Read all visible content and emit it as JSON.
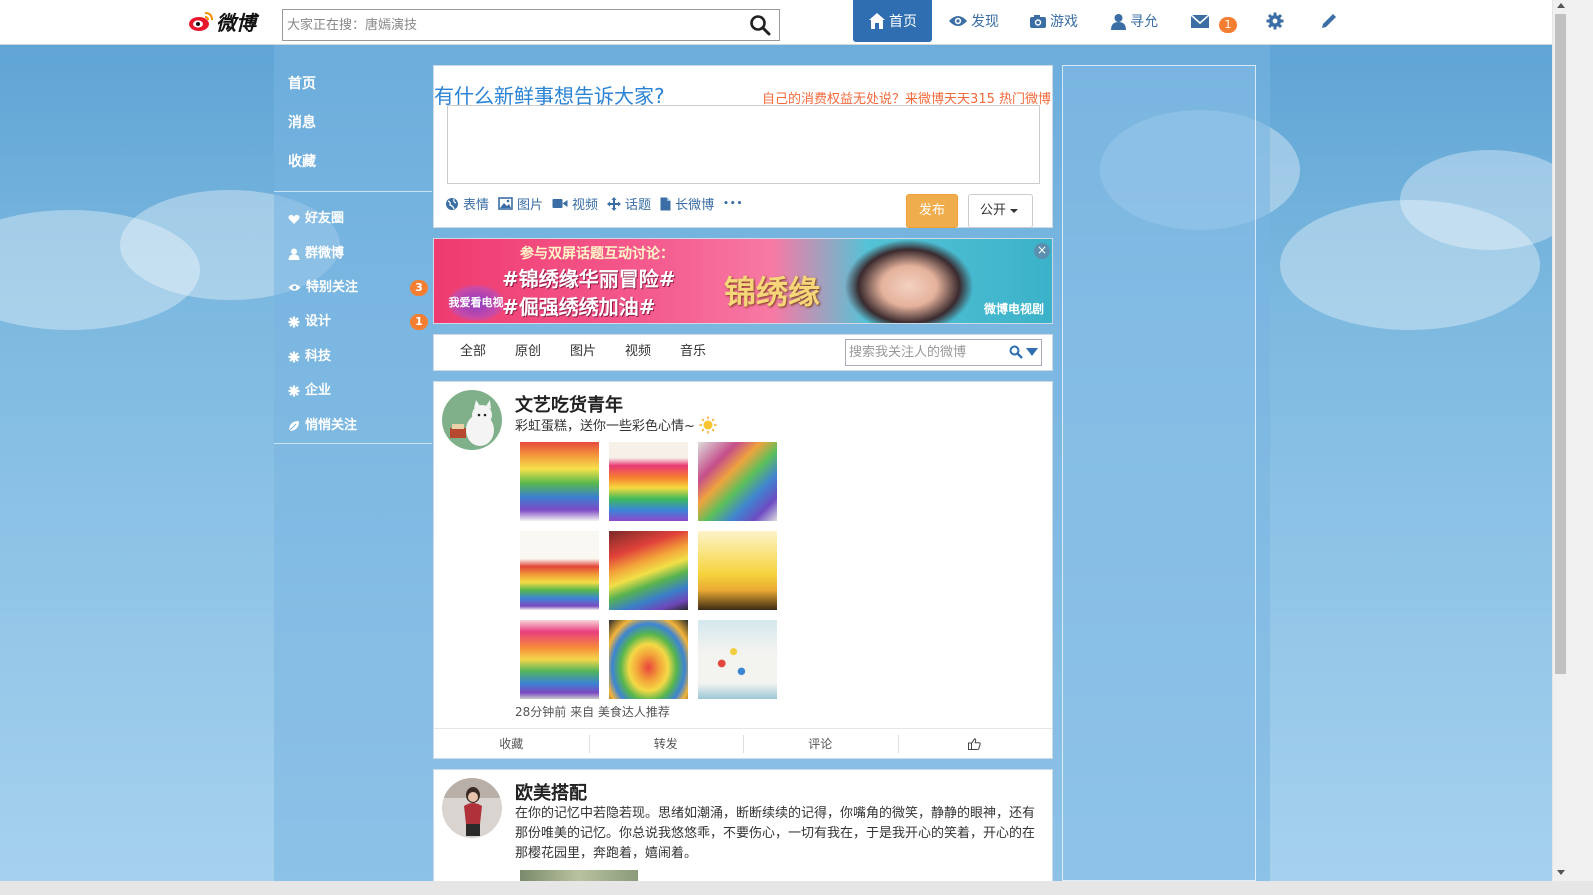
{
  "header": {
    "logo_text": "微博",
    "search_placeholder": "大家正在搜：唐嫣演技",
    "nav": [
      {
        "label": "首页",
        "icon": "home-icon",
        "active": true
      },
      {
        "label": "发现",
        "icon": "eye-icon"
      },
      {
        "label": "游戏",
        "icon": "camera-icon"
      },
      {
        "label": "寻允",
        "icon": "user-icon"
      },
      {
        "label": "",
        "icon": "mail-icon",
        "badge": "1"
      },
      {
        "label": "",
        "icon": "gear-icon"
      },
      {
        "label": "",
        "icon": "pencil-icon"
      }
    ]
  },
  "sidebar": {
    "main": [
      "首页",
      "消息",
      "收藏"
    ],
    "groups": [
      {
        "label": "好友圈",
        "icon": "heart-icon"
      },
      {
        "label": "群微博",
        "icon": "user-icon"
      },
      {
        "label": "特别关注",
        "icon": "eye-icon",
        "badge": "3"
      },
      {
        "label": "设计",
        "icon": "asterisk-icon",
        "badge": "1"
      },
      {
        "label": "科技",
        "icon": "asterisk-icon"
      },
      {
        "label": "企业",
        "icon": "asterisk-icon"
      },
      {
        "label": "悄悄关注",
        "icon": "leaf-icon"
      }
    ]
  },
  "publisher": {
    "title": "有什么新鲜事想告诉大家?",
    "hot_tip": "自己的消费权益无处说？来微博天天315 热门微博",
    "tools": [
      "表情",
      "图片",
      "视频",
      "话题",
      "长微博"
    ],
    "more": "•••",
    "submit": "发布",
    "visibility": "公开"
  },
  "banner": {
    "headline": "参与双屏话题互动讨论：",
    "tag1": "#锦绣缘华丽冒险#",
    "tag2": "#倔强绣绣加油#",
    "logo": "锦绣缘",
    "brand": "微博电视剧",
    "badge": "我爱看电视剧",
    "close": "×"
  },
  "filter": {
    "tabs": [
      "全部",
      "原创",
      "图片",
      "视频",
      "音乐"
    ],
    "search_placeholder": "搜索我关注人的微博"
  },
  "posts": [
    {
      "author": "文艺吃货青年",
      "text": "彩虹蛋糕，送你一些彩色心情~",
      "meta": "28分钟前 来自 美食达人推荐",
      "actions": [
        "收藏",
        "转发",
        "评论",
        ""
      ]
    },
    {
      "author": "欧美搭配",
      "text": "在你的记忆中若隐若现。思绪如潮涌，断断续续的记得，你嘴角的微笑，静静的眼神，还有那份唯美的记忆。你总说我悠悠乖，不要伤心，一切有我在，于是我开心的笑着，开心的在那樱花园里，奔跑着，嬉闹着。"
    }
  ],
  "colors": {
    "accent": "#2f6fb1",
    "link": "#3a6ea5",
    "badge": "#f47f32",
    "hot_tip": "#f26a3b",
    "submit": "#f0ad4e"
  }
}
